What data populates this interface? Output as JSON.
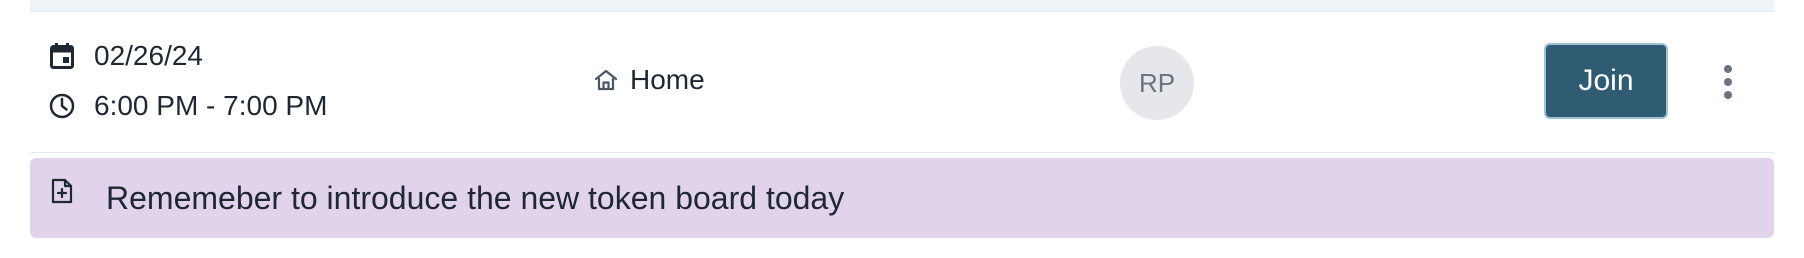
{
  "session": {
    "date": "02/26/24",
    "time": "6:00 PM - 7:00 PM",
    "location": "Home",
    "avatar_initials": "RP",
    "join_label": "Join",
    "icons": {
      "date": "calendar-icon",
      "time": "clock-icon",
      "location": "home-icon",
      "menu": "more-vertical-icon"
    }
  },
  "note": {
    "text": "Rememeber to introduce the new token board today",
    "icon": "file-plus-icon"
  },
  "colors": {
    "join_button_bg": "#2f5b73",
    "note_bg": "#e2d3ec",
    "avatar_bg": "#e5e7ea"
  }
}
